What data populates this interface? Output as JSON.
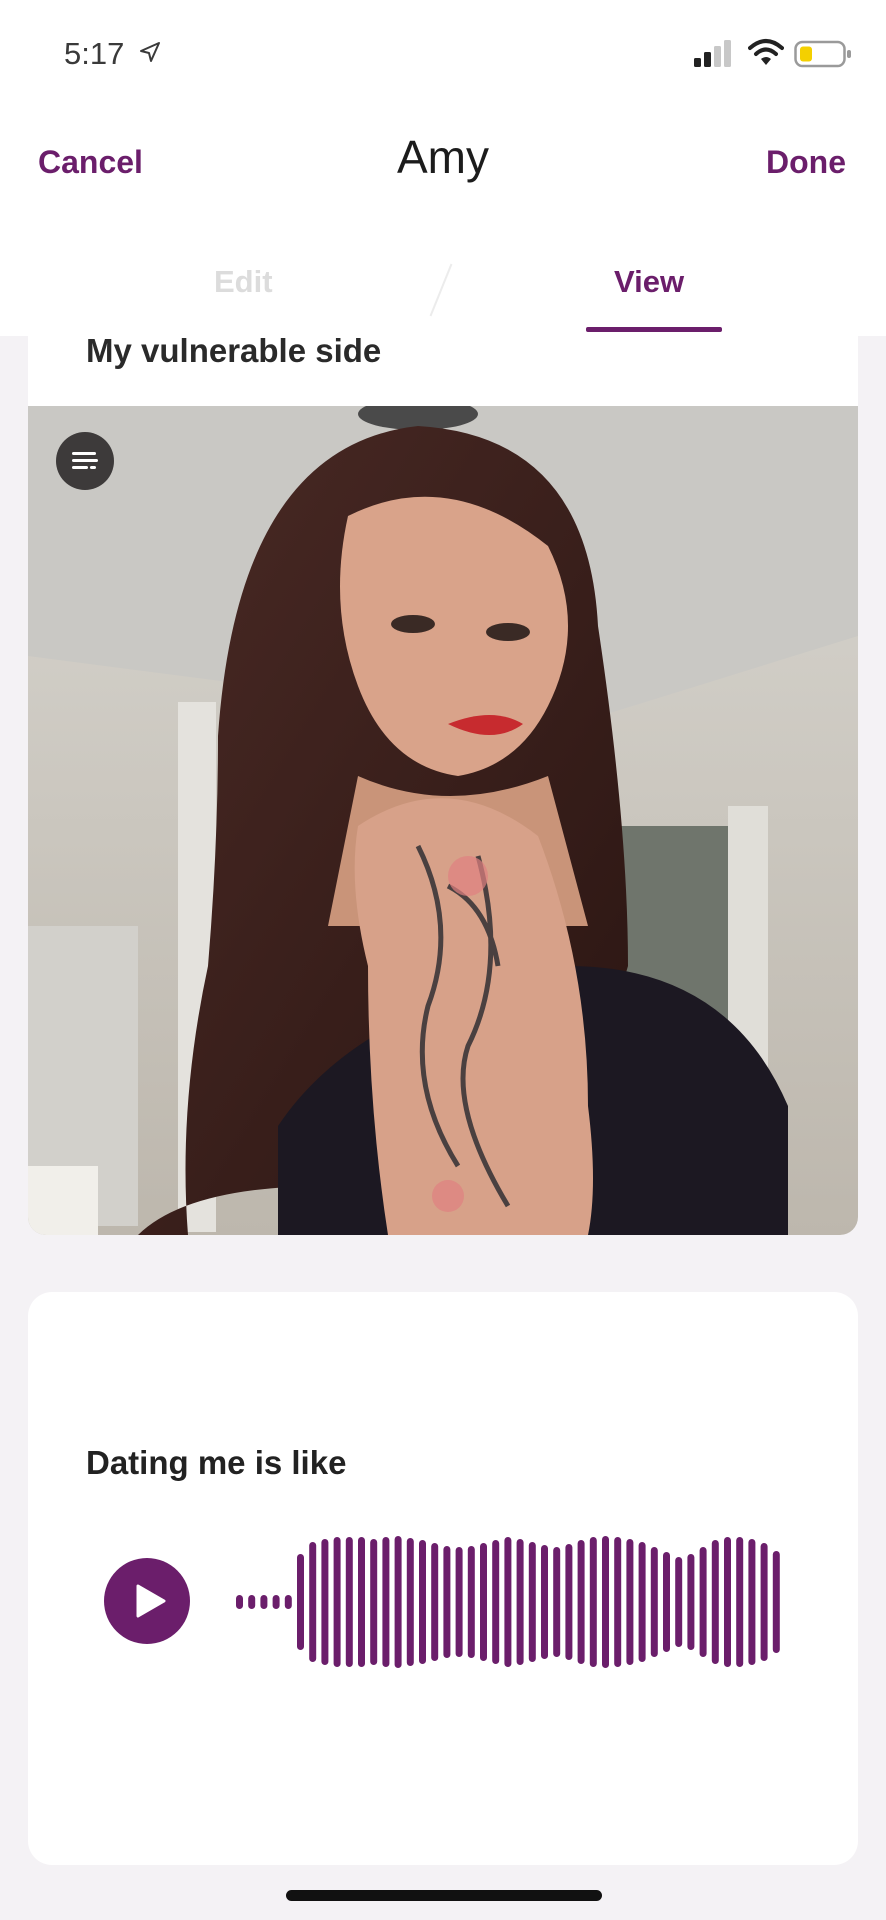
{
  "status_bar": {
    "time": "5:17",
    "location_icon": "location-arrow-icon",
    "signal_icon": "cellular-signal-icon",
    "wifi_icon": "wifi-icon",
    "battery_icon": "battery-low-icon",
    "battery_color": "#f4d000"
  },
  "header": {
    "cancel_label": "Cancel",
    "title": "Amy",
    "done_label": "Done"
  },
  "tabs": [
    {
      "label": "Edit",
      "active": false
    },
    {
      "label": "View",
      "active": true
    }
  ],
  "photo_card": {
    "prompt": "My vulnerable side",
    "menu_icon": "text-lines-icon"
  },
  "voice_card": {
    "prompt": "Dating me is like",
    "play_icon": "play-icon"
  },
  "colors": {
    "accent": "#6b1e6b",
    "background": "#f4f2f5",
    "card": "#ffffff"
  }
}
